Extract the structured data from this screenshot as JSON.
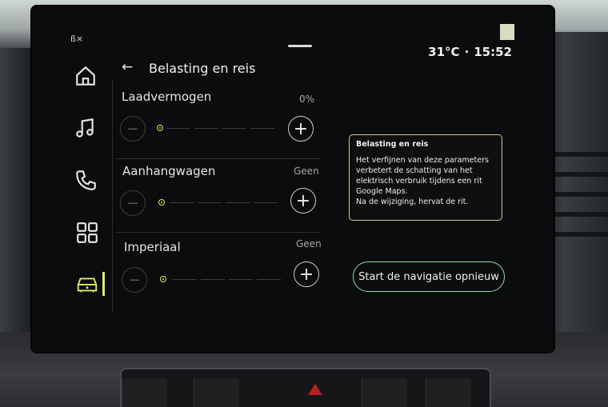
{
  "status": {
    "temperature": "31°C",
    "separator": "·",
    "time": "15:52"
  },
  "header": {
    "back_icon": "arrow-left-icon",
    "title": "Belasting en reis"
  },
  "sidebar": {
    "items": [
      {
        "icon": "home-icon"
      },
      {
        "icon": "music-icon"
      },
      {
        "icon": "phone-icon"
      },
      {
        "icon": "apps-grid-icon"
      },
      {
        "icon": "vehicle-icon",
        "active": true
      }
    ],
    "active_color": "#e2ec6a"
  },
  "settings": [
    {
      "label": "Laadvermogen",
      "value": "0%",
      "level": 0
    },
    {
      "label": "Aanhangwagen",
      "value": "Geen",
      "level": 0
    },
    {
      "label": "Imperiaal",
      "value": "Geen",
      "level": 0
    }
  ],
  "controls": {
    "minus": "−",
    "plus": "+"
  },
  "info_box": {
    "title": "Belasting en reis",
    "body_lines": [
      "Het verfijnen van deze parameters",
      "verbetert de schatting van het",
      "elektrisch verbruik tijdens een rit",
      "Google Maps.",
      "Na de wijziging, hervat de rit."
    ],
    "border_color": "#d0c990"
  },
  "cta": {
    "label": "Start de navigatie opnieuw",
    "border_color": "#8ee0a0"
  },
  "accent": "#e4ea6c"
}
